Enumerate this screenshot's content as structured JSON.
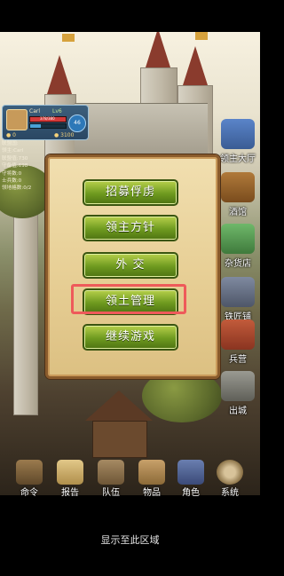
{
  "player": {
    "name": "Carl",
    "level": "Lv6",
    "hp_text": "378/380",
    "hp_fraction": 0.99,
    "exp_fraction": 0.3,
    "badge": "46",
    "coins_left": "0",
    "coins_right": "3100"
  },
  "info_lines": [
    "联盟国: ",
    "领主:Carl",
    "联盟值:730",
    "守备值:698",
    "守将数:0",
    "士兵数:0",
    "领地格数:0/2"
  ],
  "menu": {
    "recruit": "招募俘虏",
    "policy": "领主方针",
    "diplomacy": "外 交",
    "territory": "领土管理",
    "continue": "继续游戏"
  },
  "side_nav": [
    {
      "label": "领主大厅",
      "icon": "castle-hall-icon"
    },
    {
      "label": "酒馆",
      "icon": "tavern-icon"
    },
    {
      "label": "杂货店",
      "icon": "shop-icon"
    },
    {
      "label": "铁匠铺",
      "icon": "blacksmith-icon"
    },
    {
      "label": "兵营",
      "icon": "barracks-icon"
    },
    {
      "label": "出城",
      "icon": "city-gate-icon"
    }
  ],
  "bottom_nav": [
    {
      "label": "命令",
      "icon": "command-icon"
    },
    {
      "label": "报告",
      "icon": "report-icon"
    },
    {
      "label": "队伍",
      "icon": "team-icon"
    },
    {
      "label": "物品",
      "icon": "items-icon"
    },
    {
      "label": "角色",
      "icon": "character-icon"
    },
    {
      "label": "系统",
      "icon": "system-gear-icon"
    }
  ],
  "footer": "显示至此区域",
  "colors": {
    "highlight": "#ee5a5a",
    "button": "#6e9a1f",
    "panel": "#e8d097"
  }
}
